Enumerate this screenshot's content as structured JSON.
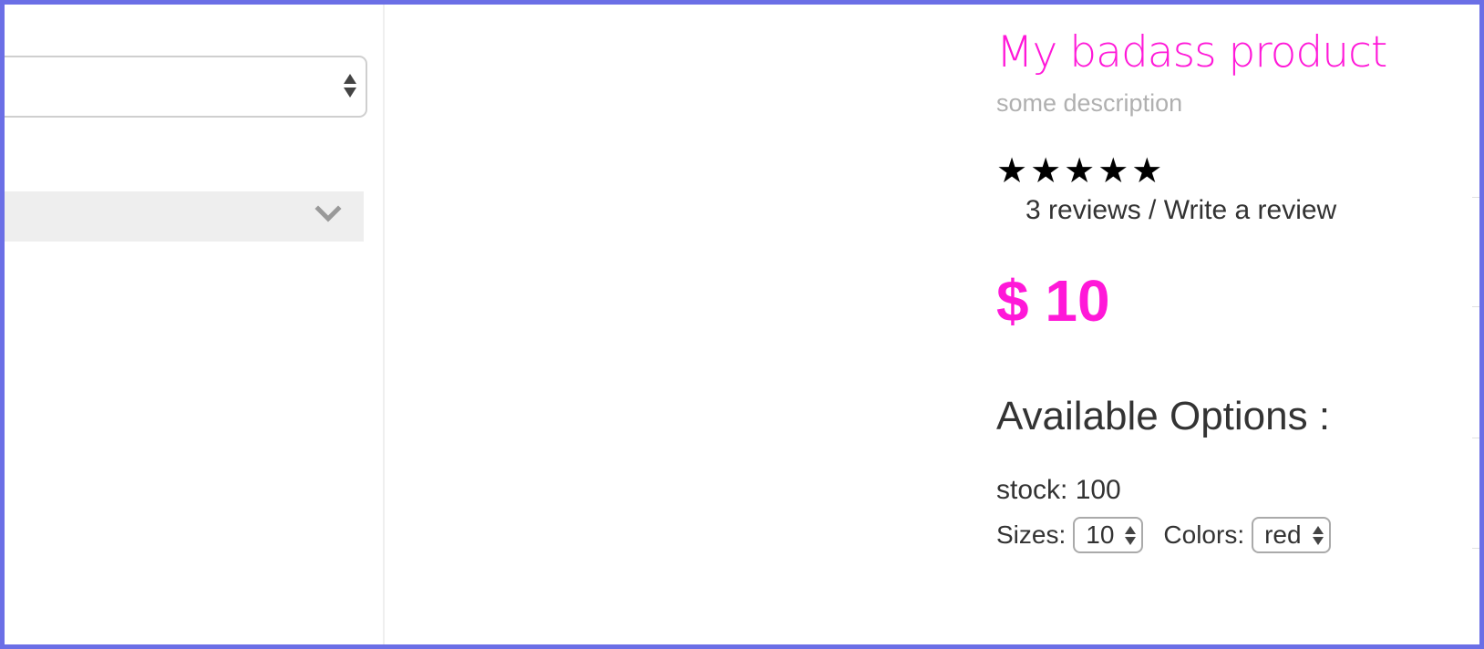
{
  "left_panel": {
    "select_value": "",
    "accordion_label": ""
  },
  "product": {
    "title": "My badass product",
    "description": "some description",
    "rating": {
      "stars": "★★★★★",
      "value": 5,
      "max": 5
    },
    "reviews_text": "3 reviews",
    "reviews_separator": " / ",
    "write_review_text": "Write a review",
    "price": "$ 10",
    "options_heading": "Available Options :",
    "stock_text": "stock: 100",
    "sizes_label": "Sizes:",
    "sizes_value": "10",
    "colors_label": "Colors:",
    "colors_value": "red"
  },
  "colors": {
    "accent": "#ff18d8",
    "frame": "#6b6fe6",
    "text": "#333333",
    "muted": "#b0b0b0"
  },
  "icons": [
    "select-arrows-icon",
    "chevron-down-icon",
    "star-icon"
  ]
}
